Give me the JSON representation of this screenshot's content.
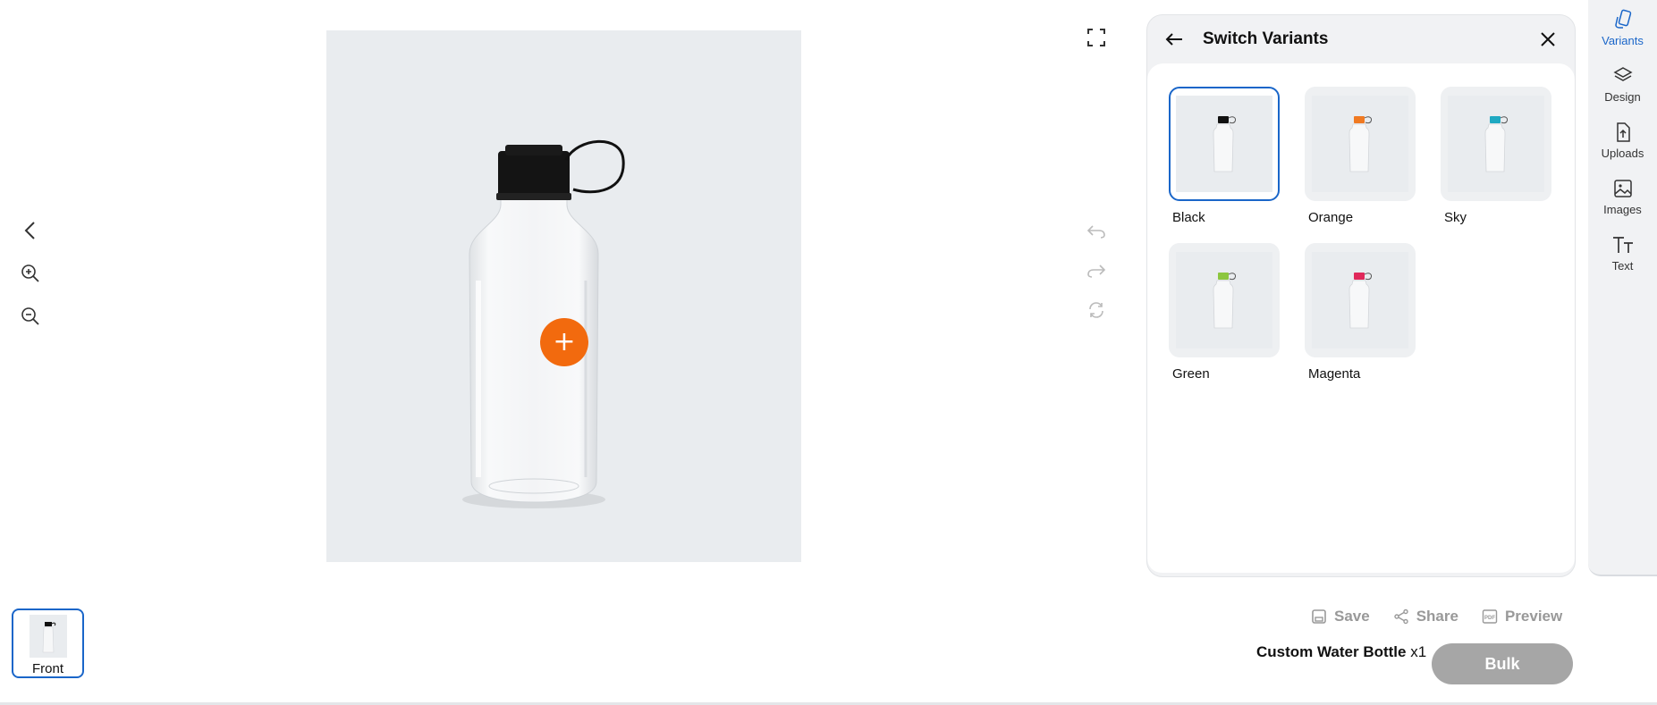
{
  "panel": {
    "title": "Switch Variants",
    "variants": [
      {
        "label": "Black",
        "cap_color": "#111111",
        "selected": true
      },
      {
        "label": "Orange",
        "cap_color": "#f07a22",
        "selected": false
      },
      {
        "label": "Sky",
        "cap_color": "#1fa9c2",
        "selected": false
      },
      {
        "label": "Green",
        "cap_color": "#8cc63f",
        "selected": false
      },
      {
        "label": "Magenta",
        "cap_color": "#e0285a",
        "selected": false
      }
    ]
  },
  "nav": {
    "items": [
      {
        "label": "Variants",
        "icon": "variants-icon",
        "active": true
      },
      {
        "label": "Design",
        "icon": "layers-icon",
        "active": false
      },
      {
        "label": "Uploads",
        "icon": "upload-icon",
        "active": false
      },
      {
        "label": "Images",
        "icon": "image-icon",
        "active": false
      },
      {
        "label": "Text",
        "icon": "text-icon",
        "active": false
      }
    ]
  },
  "views": {
    "front_label": "Front"
  },
  "actions": {
    "save": "Save",
    "share": "Share",
    "preview": "Preview"
  },
  "product": {
    "name": "Custom Water Bottle",
    "quantity": "x1"
  },
  "bulk_label": "Bulk",
  "colors": {
    "accent": "#1a66c9",
    "add_button": "#f26a0e",
    "disabled_button": "#a6a6a6"
  }
}
